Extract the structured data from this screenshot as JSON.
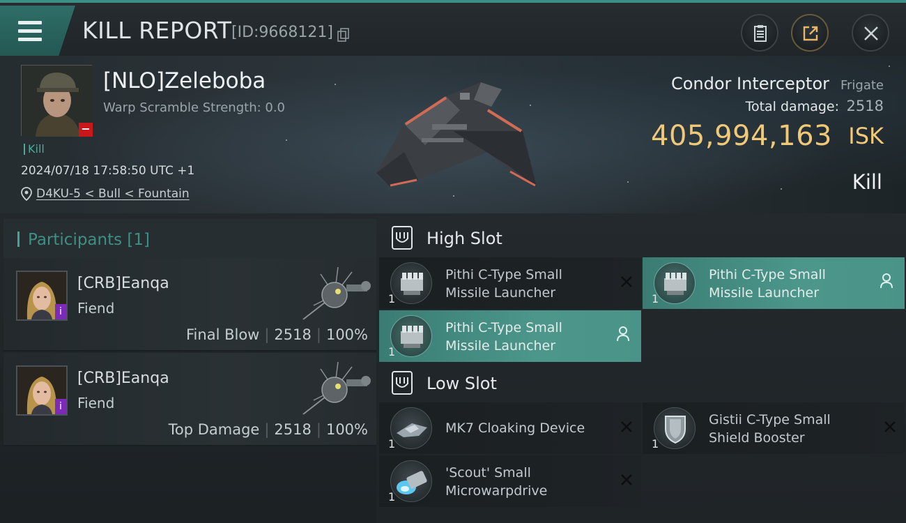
{
  "header": {
    "title": "KILL REPORT",
    "report_id": "[ID:9668121]"
  },
  "victim": {
    "name": "[NLO]Zeleboba",
    "warp_scramble": "Warp Scramble Strength: 0.0",
    "tag": "Kill",
    "datetime": "2024/07/18 17:58:50 UTC +1",
    "location": "D4KU-5 < Bull < Fountain"
  },
  "summary": {
    "ship_name": "Condor Interceptor",
    "ship_class": "Frigate",
    "total_damage_label": "Total damage:",
    "total_damage_value": "2518",
    "isk_value": "405,994,163",
    "isk_unit": "ISK",
    "result": "Kill"
  },
  "participants": {
    "label": "Participants [1]",
    "rows": [
      {
        "name": "[CRB]Eanqa",
        "ship": "Fiend",
        "role": "Final Blow",
        "damage": "2518",
        "percent": "100%"
      },
      {
        "name": "[CRB]Eanqa",
        "ship": "Fiend",
        "role": "Top Damage",
        "damage": "2518",
        "percent": "100%"
      }
    ]
  },
  "slots": {
    "high_label": "High Slot",
    "low_label": "Low Slot",
    "high": [
      {
        "qty": "1",
        "line1": "Pithi C-Type Small",
        "line2": "Missile Launcher",
        "state": "destroyed"
      },
      {
        "qty": "1",
        "line1": "Pithi C-Type Small",
        "line2": "Missile Launcher",
        "state": "dropped"
      },
      {
        "qty": "1",
        "line1": "Pithi C-Type Small",
        "line2": "Missile Launcher",
        "state": "dropped"
      }
    ],
    "low": [
      {
        "qty": "1",
        "line1": "MK7 Cloaking Device",
        "line2": "",
        "state": "destroyed"
      },
      {
        "qty": "1",
        "line1": "Gistii C-Type Small",
        "line2": "Shield Booster",
        "state": "destroyed"
      },
      {
        "qty": "1",
        "line1": "'Scout' Small",
        "line2": "Microwarpdrive",
        "state": "destroyed"
      }
    ]
  },
  "colors": {
    "accent": "#43a596",
    "isk": "#f0c978",
    "active_module": "#4c968b",
    "minus_badge": "#c8181c",
    "corp_badge": "#7b2bb8"
  },
  "icons": {
    "menu": "hamburger-icon",
    "copy": "copy-icon",
    "clipboard": "clipboard-icon",
    "share": "share-icon",
    "close": "close-icon",
    "location": "map-pin-icon",
    "slot": "slot-shield-icon",
    "destroyed": "x-icon",
    "dropped": "person-icon"
  }
}
